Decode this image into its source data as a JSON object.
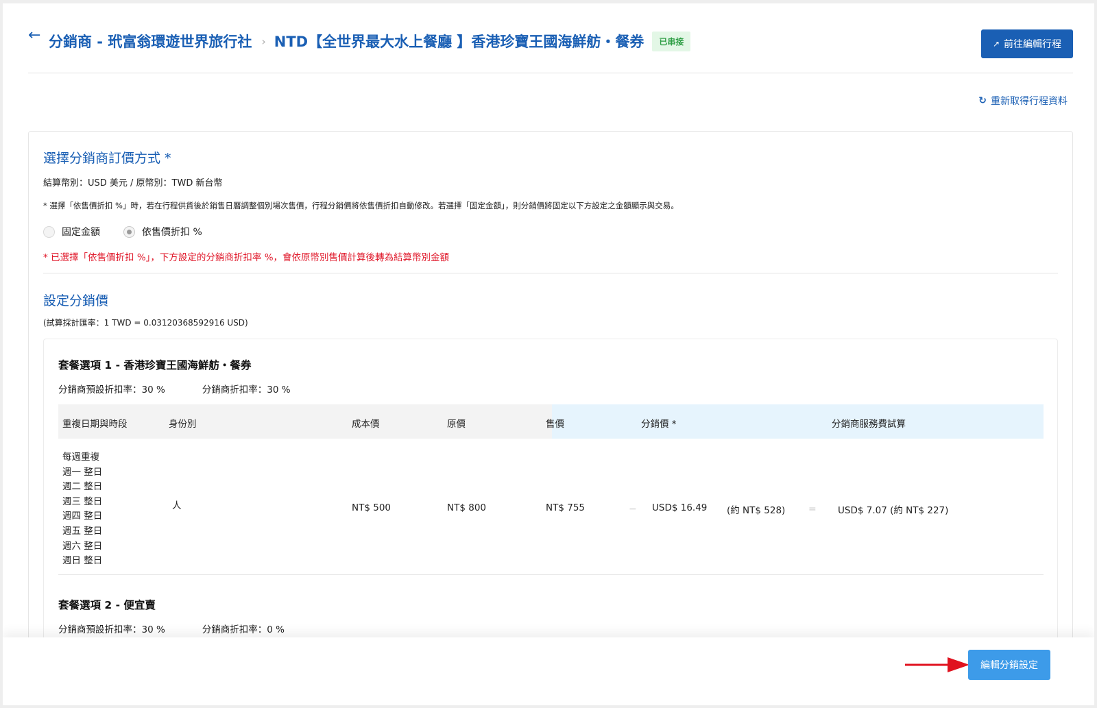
{
  "header": {
    "back_icon": "arrow-left-icon",
    "breadcrumb_1": "分銷商 - 玳富翁環遊世界旅行社",
    "breadcrumb_sep": "›",
    "breadcrumb_2": "NTD【全世界最大水上餐廳 】香港珍寶王國海鮮舫・餐券",
    "status_badge": "已串接",
    "edit_trip_button": "前往編輯行程"
  },
  "refresh_link": "重新取得行程資料",
  "pricing_method": {
    "title": "選擇分銷商訂價方式 *",
    "currency_line": "結算幣別：USD 美元 / 原幣別：TWD 新台幣",
    "note": "* 選擇「依售價折扣 %」時，若在行程供貨後於銷售日曆調整個別場次售價，行程分銷價將依售價折扣自動修改。若選擇「固定金額」，則分銷價將固定以下方設定之金額顯示與交易。",
    "options": [
      {
        "label": "固定金額",
        "selected": false
      },
      {
        "label": "依售價折扣 %",
        "selected": true
      }
    ],
    "warning": "* 已選擇「依售價折扣 %」，下方設定的分銷商折扣率 %，會依原幣別售價計算後轉為結算幣別金額"
  },
  "distribution_price": {
    "title": "設定分銷價",
    "exchange_rate": "(試算採計匯率：1 TWD = 0.03120368592916 USD)",
    "packages": [
      {
        "title": "套餐選項 1 - 香港珍寶王國海鮮舫・餐券",
        "default_rate": "分銷商預設折扣率：30 %",
        "rate": "分銷商折扣率：30 %"
      },
      {
        "title": "套餐選項 2 - 便宜賣",
        "default_rate": "分銷商預設折扣率：30 %",
        "rate": "分銷商折扣率：0 %"
      }
    ],
    "table": {
      "headers": [
        "重複日期與時段",
        "身份別",
        "成本價",
        "原價",
        "售價",
        "分銷價 *",
        "分銷商服務費試算"
      ],
      "row": {
        "days": [
          "每週重複",
          "週一 整日",
          "週二 整日",
          "週三 整日",
          "週四 整日",
          "週五 整日",
          "週六 整日",
          "週日 整日"
        ],
        "identity": "人",
        "cost": "NT$ 500",
        "original": "NT$ 800",
        "sale": "NT$ 755",
        "minus": "−",
        "dist_usd": "USD$ 16.49",
        "dist_ntd": "(約 NT$ 528)",
        "equals": "=",
        "fee": "USD$ 7.07 (約 NT$ 227)"
      }
    }
  },
  "bottom_button": "編輯分銷設定",
  "colors": {
    "primary": "#1a5fb4",
    "button_light": "#3d9be9",
    "warning": "#e0192b",
    "badge_green": "#2e9e45",
    "arrow_red": "#e0121f"
  }
}
